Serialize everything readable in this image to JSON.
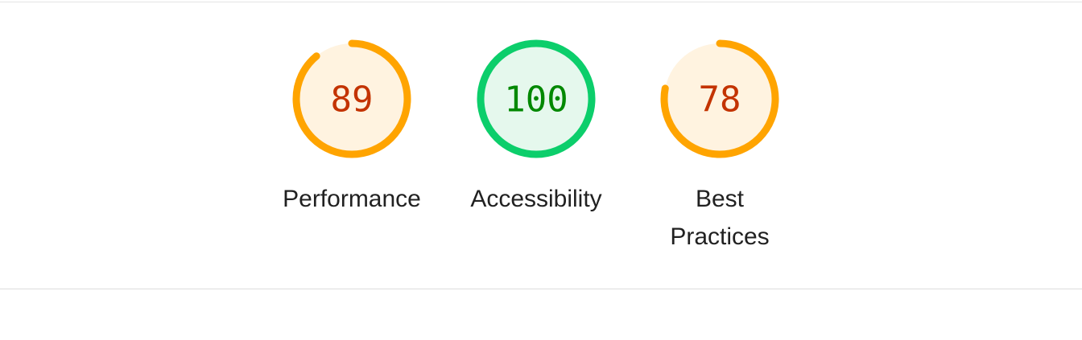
{
  "colors": {
    "average": "#ffa400",
    "average_fill": "#fff3e0",
    "average_text": "#c33300",
    "pass": "#0cce6b",
    "pass_fill": "#e5f8ed",
    "pass_text": "#008800",
    "track": "#fdf3e8"
  },
  "gauges": [
    {
      "label": "Performance",
      "score": 89,
      "rating": "average"
    },
    {
      "label": "Accessibility",
      "score": 100,
      "rating": "pass"
    },
    {
      "label": "Best Practices",
      "score": 78,
      "rating": "average"
    }
  ]
}
